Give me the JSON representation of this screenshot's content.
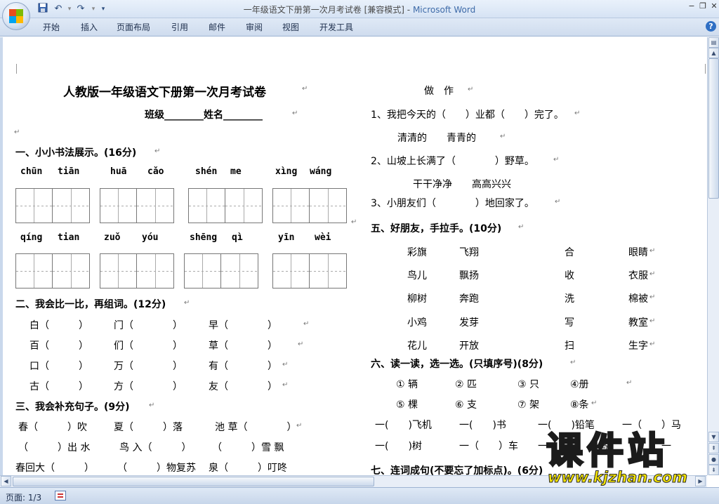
{
  "window": {
    "title_doc": "一年级语文下册第一次月考试卷 [兼容模式]",
    "title_sep": " - ",
    "title_app": "Microsoft Word",
    "icons": [
      "office-button-icon",
      "save-icon",
      "undo-icon",
      "redo-icon",
      "customize-qat-icon",
      "minimize-icon",
      "restore-icon",
      "help-icon"
    ]
  },
  "ribbon": {
    "tabs": [
      "开始",
      "插入",
      "页面布局",
      "引用",
      "邮件",
      "审阅",
      "视图",
      "开发工具"
    ]
  },
  "document": {
    "title": "人教版一年级语文下册第一次月考试卷",
    "class_line": "班级________姓名________",
    "para_mark": "↵",
    "section1": {
      "heading": "一、小小书法展示。(16分)",
      "row1_pinyin": [
        "chūn",
        "tiān",
        "huā",
        "cǎo",
        "shén",
        "me",
        "xìng",
        "wáng"
      ],
      "row2_pinyin": [
        "qíng",
        "tian",
        "zuǒ",
        "yóu",
        "shēng",
        "qì",
        "yīn",
        "wèi"
      ]
    },
    "section2": {
      "heading": "二、我会比一比，再组词。(12分)",
      "rows": [
        [
          "白（　　　）",
          "门（　　　　）",
          "早（　　　　）"
        ],
        [
          "百（　　　）",
          "们（　　　　）",
          "草（　　　　）"
        ],
        [
          "口（　　　）",
          "万（　　　　）",
          "有（　　　　）"
        ],
        [
          "古（　　　）",
          "方（　　　　）",
          "友（　　　　）"
        ]
      ]
    },
    "section3": {
      "heading": "三、我会补充句子。(9分)",
      "rows": [
        [
          "春（　　　）吹",
          "夏（　　　）落",
          "池 草（　　　　）"
        ],
        [
          "（　　　）出 水",
          "鸟 入（　　　）",
          "（　　　）雪 飘"
        ],
        [
          "春回大（　　　）",
          "（　　　）物复苏",
          "泉（　　　）叮咚"
        ]
      ]
    },
    "right_col": {
      "zuozuo": "做　作",
      "q1": "1、我把今天的（　　）业都（　　）完了。",
      "q1_opts": "清清的　　青青的",
      "q2": "2、山坡上长满了（　　　　）野草。",
      "q2_opts": "干干净净　　高高兴兴",
      "q3": "3、小朋友们（　　　　）地回家了。"
    },
    "section5": {
      "heading": "五、好朋友，手拉手。(10分)",
      "left_pairs": [
        [
          "彩旗",
          "飞翔"
        ],
        [
          "鸟儿",
          "飘扬"
        ],
        [
          "柳树",
          "奔跑"
        ],
        [
          "小鸡",
          "发芽"
        ],
        [
          "花儿",
          "开放"
        ]
      ],
      "right_pairs": [
        [
          "合",
          "眼睛"
        ],
        [
          "收",
          "衣服"
        ],
        [
          "洗",
          "棉被"
        ],
        [
          "写",
          "教室"
        ],
        [
          "扫",
          "生字"
        ]
      ]
    },
    "section6": {
      "heading": "六、读一读，选一选。(只填序号)(8分)",
      "opts_row1": [
        "① 辆",
        "② 匹",
        "③ 只",
        "④册"
      ],
      "opts_row2": [
        "⑤ 棵",
        "⑥ 支",
        "⑦ 架",
        "⑧条"
      ],
      "fill_row1": [
        "一(　　)飞机",
        "一(　　)书",
        "一(　　)铅笔",
        "一（　　）马"
      ],
      "fill_row2": [
        "一(　　)树",
        "一（　　）车",
        "一",
        "鸟",
        "一"
      ]
    },
    "section7": {
      "heading": "七、连词成句(不要忘了加标点)。(6分)"
    }
  },
  "statusbar": {
    "page": "页面: 1/3"
  },
  "watermark": {
    "title": "课件站",
    "url": "www.kjzhan.com"
  }
}
